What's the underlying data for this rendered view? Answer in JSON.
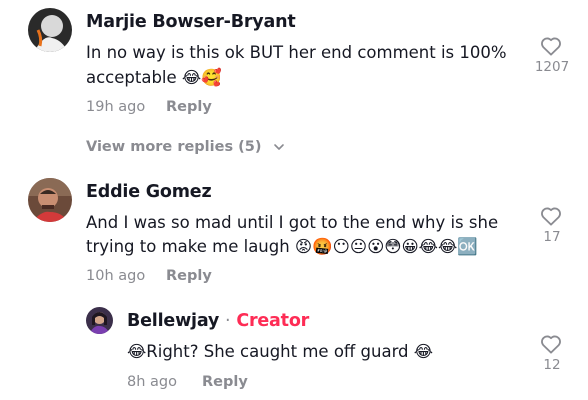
{
  "comments": [
    {
      "author": "Marjie Bowser-Bryant",
      "line1": "In no way is this ok BUT her end comment is 100%",
      "line2": "acceptable 😂🥰",
      "time": "19h ago",
      "reply_label": "Reply",
      "likes": "1207"
    },
    {
      "author": "Eddie Gomez",
      "line1": "And I was so mad until I got to the end why is she",
      "line2": "trying to make me laugh 😡🤬😶😐😮😳😀😂😂🆗",
      "time": "10h ago",
      "reply_label": "Reply",
      "likes": "17"
    }
  ],
  "view_more": "View more replies (5)",
  "creator_reply": {
    "author": "Bellewjay",
    "separator": "·",
    "badge": "Creator",
    "text": "😂Right? She caught me off guard 😂",
    "time": "8h ago",
    "reply_label": "Reply",
    "likes": "12"
  },
  "icons": {
    "like": "heart-outline-icon",
    "expand": "chevron-down-icon"
  },
  "colors": {
    "accent": "#fe2c55",
    "muted": "#8a8b91",
    "text": "#161823"
  }
}
